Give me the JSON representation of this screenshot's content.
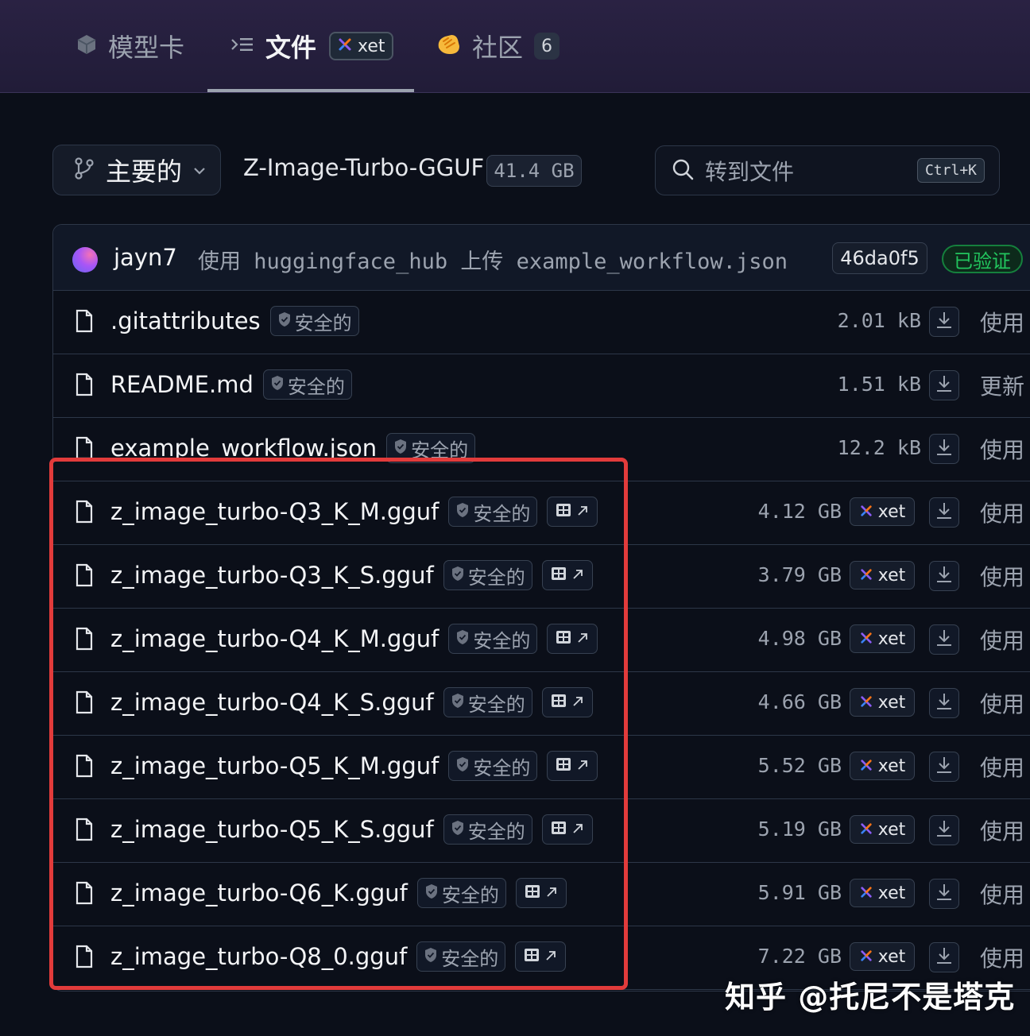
{
  "tabs": [
    {
      "label": "模型卡",
      "icon": "cube-icon"
    },
    {
      "label": "文件",
      "icon": "files-icon",
      "badge": "xet"
    },
    {
      "label": "社区",
      "icon": "hands-icon",
      "count": "6"
    }
  ],
  "branch": {
    "label": "主要的"
  },
  "repo": {
    "name": "Z-Image-Turbo-GGUF",
    "size": "41.4 GB"
  },
  "search": {
    "placeholder": "转到文件",
    "shortcut": "Ctrl+K"
  },
  "commit": {
    "user": "jayn7",
    "message": "使用 huggingface_hub 上传 example_workflow.json",
    "hash": "46da0f5",
    "status": "已验证"
  },
  "safe_label": "安全的",
  "files": [
    {
      "name": ".gitattributes",
      "size": "2.01 kB",
      "xet": false,
      "ext": false,
      "action": "使用"
    },
    {
      "name": "README.md",
      "size": "1.51 kB",
      "xet": false,
      "ext": false,
      "action": "更新"
    },
    {
      "name": "example_workflow.json",
      "size": "12.2 kB",
      "xet": false,
      "ext": false,
      "action": "使用"
    },
    {
      "name": "z_image_turbo-Q3_K_M.gguf",
      "size": "4.12 GB",
      "xet": true,
      "ext": true,
      "action": "使用"
    },
    {
      "name": "z_image_turbo-Q3_K_S.gguf",
      "size": "3.79 GB",
      "xet": true,
      "ext": true,
      "action": "使用"
    },
    {
      "name": "z_image_turbo-Q4_K_M.gguf",
      "size": "4.98 GB",
      "xet": true,
      "ext": true,
      "action": "使用"
    },
    {
      "name": "z_image_turbo-Q4_K_S.gguf",
      "size": "4.66 GB",
      "xet": true,
      "ext": true,
      "action": "使用"
    },
    {
      "name": "z_image_turbo-Q5_K_M.gguf",
      "size": "5.52 GB",
      "xet": true,
      "ext": true,
      "action": "使用"
    },
    {
      "name": "z_image_turbo-Q5_K_S.gguf",
      "size": "5.19 GB",
      "xet": true,
      "ext": true,
      "action": "使用"
    },
    {
      "name": "z_image_turbo-Q6_K.gguf",
      "size": "5.91 GB",
      "xet": true,
      "ext": true,
      "action": "使用"
    },
    {
      "name": "z_image_turbo-Q8_0.gguf",
      "size": "7.22 GB",
      "xet": true,
      "ext": true,
      "action": "使用"
    }
  ],
  "xet_label": "xet",
  "watermark": "知乎 @托尼不是塔克",
  "colors": {
    "highlight": "#e23b3b",
    "verified": "#22c55e",
    "xet_accent": "#8b5cf6"
  }
}
